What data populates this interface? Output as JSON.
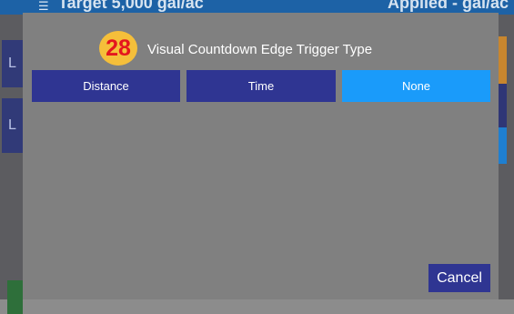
{
  "background": {
    "header": {
      "menu_icon": "hamburger-icon",
      "target_text": "Target 5,000 gal/ac",
      "applied_text": "Applied - gal/ac"
    },
    "left_tiles": [
      "L",
      "L"
    ]
  },
  "dialog": {
    "step_number": "28",
    "title": "Visual Countdown Edge Trigger Type",
    "options": [
      {
        "label": "Distance",
        "selected": false
      },
      {
        "label": "Time",
        "selected": false
      },
      {
        "label": "None",
        "selected": true
      }
    ],
    "cancel_label": "Cancel"
  },
  "colors": {
    "overlay": "#808080",
    "option_default": "#2f3592",
    "option_selected": "#1a9bfa",
    "badge_fill": "#f5bf3a",
    "badge_text": "#e4161e",
    "app_bar": "#1d62a6"
  }
}
